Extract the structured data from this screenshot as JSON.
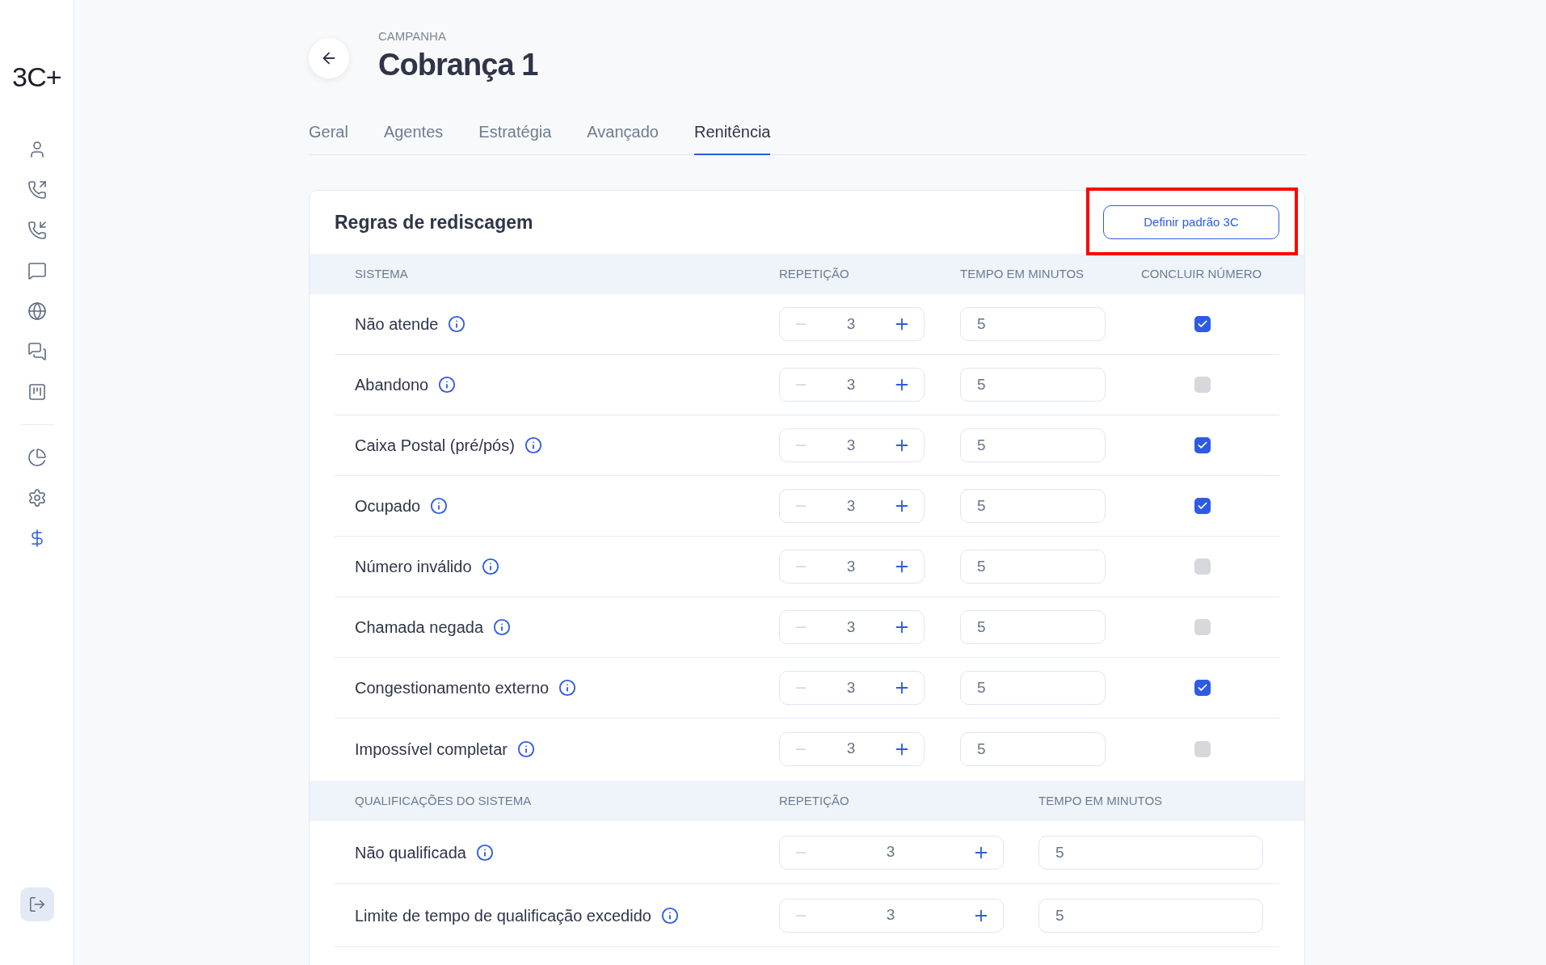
{
  "sidebar": {
    "logo": "3C+",
    "items": [
      {
        "kind": "link",
        "selected": false
      },
      {
        "kind": "link",
        "selected": false
      },
      {
        "kind": "link",
        "selected": false
      },
      {
        "kind": "link",
        "selected": false
      },
      {
        "kind": "link",
        "selected": false
      },
      {
        "kind": "link",
        "selected": false
      },
      {
        "kind": "link",
        "selected": false
      },
      {
        "kind": "divider"
      },
      {
        "kind": "link",
        "selected": false
      },
      {
        "kind": "link",
        "selected": false
      },
      {
        "kind": "link",
        "selected": true
      }
    ]
  },
  "header": {
    "eyebrow": "CAMPANHA",
    "title": "Cobrança 1"
  },
  "tabs": [
    {
      "label": "Geral",
      "selected": false
    },
    {
      "label": "Agentes",
      "selected": false
    },
    {
      "label": "Estratégia",
      "selected": false
    },
    {
      "label": "Avançado",
      "selected": false
    },
    {
      "label": "Renitência",
      "selected": true
    }
  ],
  "card": {
    "title": "Regras de rediscagem",
    "button": "Definir padrão 3C",
    "button_highlighted": true
  },
  "system": {
    "columns": [
      "SISTEMA",
      "REPETIÇÃO",
      "TEMPO EM MINUTOS",
      "CONCLUIR NÚMERO"
    ],
    "rows": [
      {
        "name": "Não atende",
        "repetition": "3",
        "minutes": "5",
        "checked": true
      },
      {
        "name": "Abandono",
        "repetition": "3",
        "minutes": "5",
        "checked": false
      },
      {
        "name": "Caixa Postal (pré/pós)",
        "repetition": "3",
        "minutes": "5",
        "checked": true
      },
      {
        "name": "Ocupado",
        "repetition": "3",
        "minutes": "5",
        "checked": true
      },
      {
        "name": "Número inválido",
        "repetition": "3",
        "minutes": "5",
        "checked": false
      },
      {
        "name": "Chamada negada",
        "repetition": "3",
        "minutes": "5",
        "checked": false
      },
      {
        "name": "Congestionamento externo",
        "repetition": "3",
        "minutes": "5",
        "checked": true
      },
      {
        "name": "Impossível completar",
        "repetition": "3",
        "minutes": "5",
        "checked": false
      }
    ]
  },
  "qualifications": {
    "columns": [
      "QUALIFICAÇÕES DO SISTEMA",
      "REPETIÇÃO",
      "TEMPO EM MINUTOS"
    ],
    "rows": [
      {
        "name": "Não qualificada",
        "repetition": "3",
        "minutes": "5"
      },
      {
        "name": "Limite de tempo de qualificação excedido",
        "repetition": "3",
        "minutes": "5"
      }
    ]
  }
}
